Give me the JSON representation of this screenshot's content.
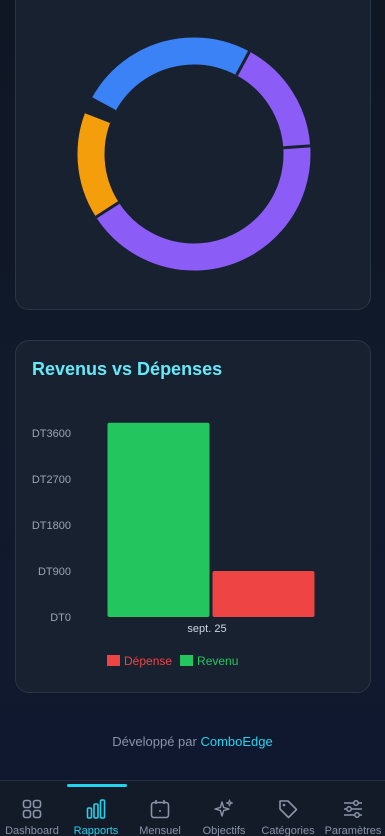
{
  "donut_chart": {
    "segments": [
      {
        "value": 42,
        "color": "#8b5cf6"
      },
      {
        "value": 15,
        "color": "#f59e0b"
      },
      {
        "value": 2,
        "color": "#182130"
      },
      {
        "value": 25,
        "color": "#3b82f6"
      },
      {
        "value": 16,
        "color": "#8b5cf6"
      }
    ]
  },
  "bar_card": {
    "title": "Revenus vs Dépenses"
  },
  "chart_data": {
    "type": "bar",
    "categories": [
      "sept. 25"
    ],
    "series": [
      {
        "name": "Revenu",
        "values": [
          3800
        ],
        "color": "#22c55e"
      },
      {
        "name": "Dépense",
        "values": [
          900
        ],
        "color": "#ef4444"
      }
    ],
    "yticks": [
      "DT0",
      "DT900",
      "DT1800",
      "DT2700",
      "DT3600"
    ],
    "ytick_values": [
      0,
      900,
      1800,
      2700,
      3600
    ],
    "ylim": [
      0,
      3600
    ],
    "legend": [
      {
        "label": "Dépense",
        "color": "#ef4444"
      },
      {
        "label": "Revenu",
        "color": "#22c55e"
      }
    ],
    "legend_position": "bottom"
  },
  "footer": {
    "prefix": "Développé par",
    "brand": "ComboEdge"
  },
  "nav": {
    "items": [
      {
        "label": "Dashboard",
        "icon": "grid-icon"
      },
      {
        "label": "Rapports",
        "icon": "bar-chart-icon",
        "active": true
      },
      {
        "label": "Mensuel",
        "icon": "calendar-icon"
      },
      {
        "label": "Objectifs",
        "icon": "sparkles-icon"
      },
      {
        "label": "Catégories",
        "icon": "tag-icon"
      },
      {
        "label": "Paramètres",
        "icon": "sliders-icon"
      }
    ]
  }
}
